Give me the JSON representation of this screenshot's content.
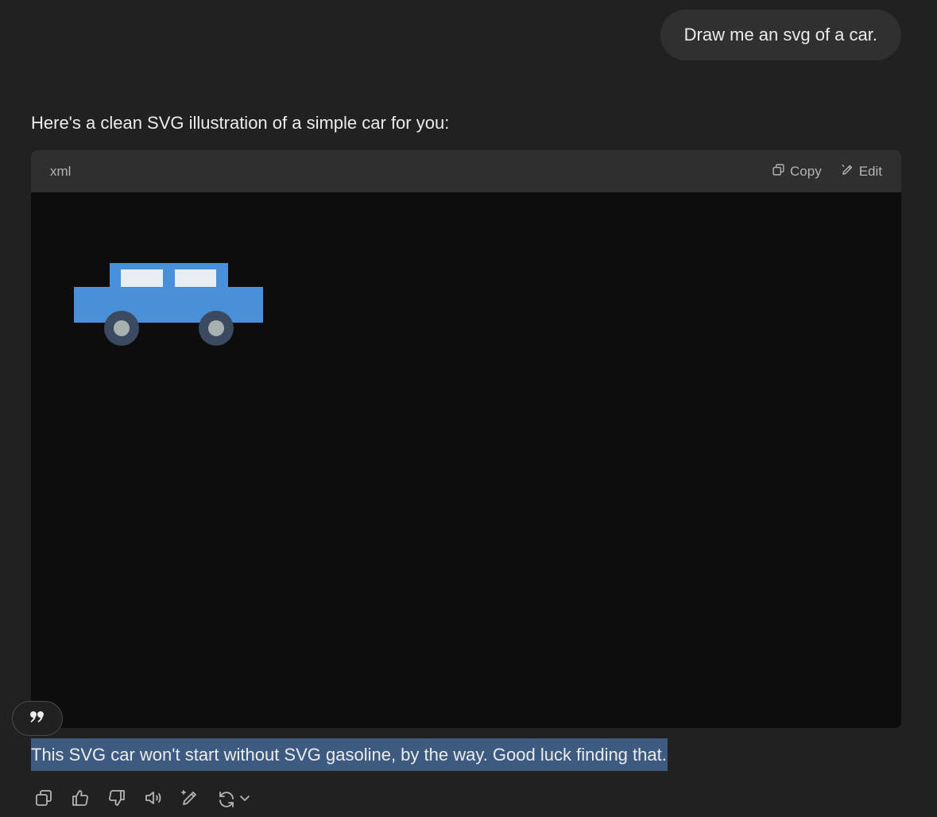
{
  "conversation": {
    "user_message": "Draw me an svg of a car.",
    "assistant_intro": "Here's a clean SVG illustration of a simple car for you:",
    "code_block": {
      "language": "xml",
      "copy_label": "Copy",
      "edit_label": "Edit"
    },
    "selected_text": "This SVG car won't start without SVG gasoline, by the way. Good luck finding that."
  },
  "car_colors": {
    "body": "#4a90d9",
    "window": "#e8eef4",
    "tire": "#3b4a60",
    "hubcap": "#a8b0b0"
  },
  "icons": {
    "quote": "quote-icon",
    "actions": [
      "copy-icon",
      "thumbs-up-icon",
      "thumbs-down-icon",
      "speaker-icon",
      "edit-pen-icon",
      "regenerate-icon",
      "chevron-down-icon"
    ]
  }
}
